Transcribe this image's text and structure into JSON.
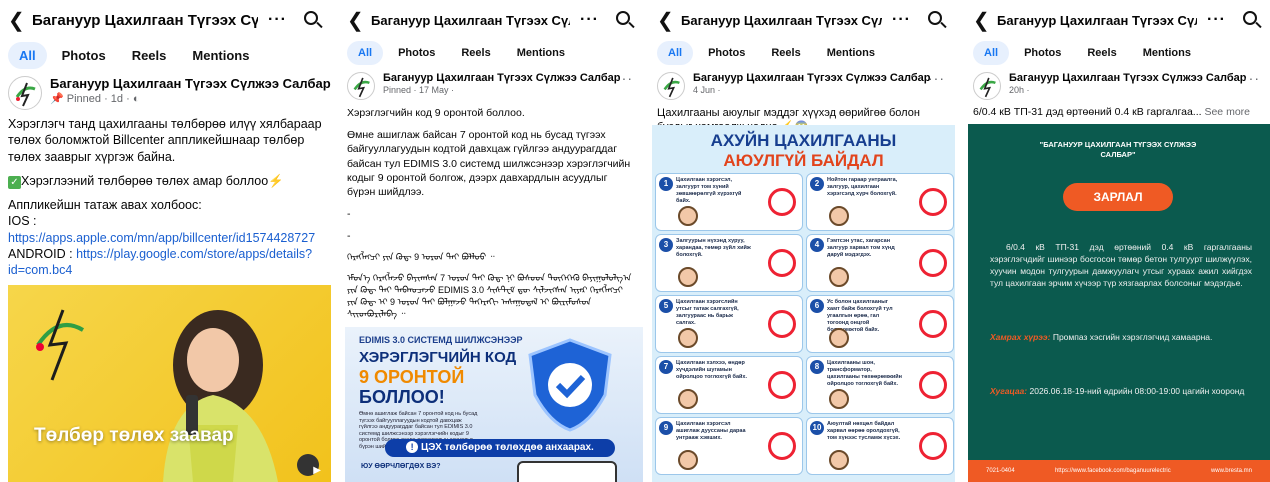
{
  "panel1": {
    "title": "Багануур Цахилгаан Түгээх Сүл...",
    "tabs": [
      "All",
      "Photos",
      "Reels",
      "Mentions"
    ],
    "page_name": "Багануур Цахилгаан Түгээх Сүлжээ Салбар",
    "meta": "Pinned · 1d ·",
    "text1": "Хэрэглэгч танд цахилгааны төлбөрөө илүү хялбараар төлөх боломжтой Billcenter аппликейшнаар төлбөр төлөх зааврыг хүргэж байна.",
    "text2": "Хэрэглээний төлбөрөө төлөх амар боллоо",
    "text3": "Аппликейшн татаж авах холбоос:",
    "ios_label": "IOS :",
    "ios_link": "https://apps.apple.com/mn/app/billcenter/id1574428727",
    "android_label": "ANDROID :",
    "android_link": "https://play.google.com/store/apps/details?id=com.bc4",
    "image_caption": "Төлбөр төлөх заавар"
  },
  "panel2": {
    "title": "Багануур Цахилгаан Түгээх Сүл...",
    "tabs": [
      "All",
      "Photos",
      "Reels",
      "Mentions"
    ],
    "page_name": "Багануур Цахилгаан Түгээх Сүлжээ Салбар",
    "meta": "Pinned · 17 May ·",
    "text1": "Хэрэглэгчийн код 9 оронтой боллоо.",
    "text2": "Өмне ашиглаж байсан 7 оронтой код нь бусад түгээх байгууллагуудын кодтой давхцаж гүйлгээ андуурагддаг байсан тул EDIMIS 3.0 системд шилжсэнээр хэрэглэгчийн кодыг 9 оронтой болгож, дээрх давхардлын асуудлыг бүрэн шийдлээ.",
    "dash1": "-",
    "dash2": "-",
    "mongol1": "ᠬᠡᠷᠡᠭᠯᠡᠭᠴᠢ ᠶᠢᠨ ᠺᠣᠳ᠋ 9 ᠣᠷᠣᠨ ᠲᠠᠢ ᠪᠣᠯᠯᠣᠣ ᠃",
    "mongol2": "ᠡᠮᠦᠨ᠎ᠡ ᠬᠡᠷᠡᠭᠯᠡᠵᠦ ᠪᠠᠶᠢᠭᠰᠠᠨ 7 ᠣᠷᠣᠨ ᠲᠠᠢ ᠺᠣᠳ᠋ ᠨᠢ ᠪᠤᠰᠤᠳ ᠲᠦᠭᠡᠭᠡᠬᠦ ᠪᠠᠶᠢᠭᠤᠯᠤᠯᠭ᠎ᠠ ᠶᠢᠨ ᠺᠣᠳ᠋ ᠲᠠᠢ ᠳᠠᠪᠬᠤᠴᠠᠵᠤ EDIMIS 3.0 ᠰᠢᠰᠲ᠋ᠧᠮ ᠳᠦ ᠰᠢᠯᠵᠢᠭᠰᠡᠨ ᠢᠶᠡᠷ ᠬᠡᠷᠡᠭᠯᠡᠭᠴᠢ ᠶᠢᠨ ᠺᠣᠳ᠋ ᠢ 9 ᠣᠷᠣᠨ ᠲᠠᠢ ᠪᠣᠯᠭᠠᠵᠤ ᠳᠡᠭᠡᠷᠡᠬᠢ ᠠᠰᠠᠭᠤᠳᠠᠯ ᠢ ᠪᠦᠷᠢᠮᠦᠰᠦᠨ ᠰᠢᠢᠳᠪᠦᠷᠢᠯᠡᠪᠡ ᠃",
    "img_system": "EDIMIS 3.0 СИСТЕМД ШИЛЖСЭНЭЭР",
    "img_headline1": "ХЭРЭГЛЭГЧИЙН КОД",
    "img_headline2": "9 ОРОНТОЙ",
    "img_headline3": "БОЛЛОО!",
    "img_small": "Өмнө ашиглаж байсан 7 оронтой код нь бусад түгээх байгууллагуудын кодтой давхцаж гүйлгээ андуурагддаг байсан тул EDIMIS 3.0 системд шилжсэнээр хэрэглэгчийн кодыг 9 оронтой болгож дээрх давхардлын асуудлыг бүрэн шийдлээ.",
    "img_banner": "ЦЭХ төлбөрөө төлөхдөө анхаарах.",
    "img_bottom": "ЮУ ӨӨРЧЛӨГДӨХ ВЭ?"
  },
  "panel3": {
    "title": "Багануур Цахилгаан Түгээх Сүл...",
    "tabs": [
      "All",
      "Photos",
      "Reels",
      "Mentions"
    ],
    "page_name": "Багануур Цахилгаан Түгээх Сүлжээ Салбар",
    "meta": "4 Jun ·",
    "text1": "Цахилгааны аюулыг мэддэг хүүхэд өөрийгөө болон бусдыг хамгаалж чадна",
    "poster_title1": "АХУЙН ЦАХИЛГААНЫ",
    "poster_title2": "АЮУЛГҮЙ БАЙДАЛ",
    "tips": [
      {
        "n": "1",
        "t": "Цахилгаан хэрэгсэл, залгуурт том хүний зөвшөөрөлгүй хүрэхгүй байх."
      },
      {
        "n": "2",
        "t": "Нойтон гараар унтраалга, залгуур, цахилгаан хэрэгсэлд хүрч болохгүй."
      },
      {
        "n": "3",
        "t": "Залгуурын нүхэнд хуруу, харандаа, төмөр зүйл хийж болохгүй."
      },
      {
        "n": "4",
        "t": "Гэмтсэн утас, хагарсан залгуур харвал том хүнд даруй мэдэгдэх."
      },
      {
        "n": "5",
        "t": "Цахилгаан хэрэгслийн утсыг татаж салгахгүй, залгуураас нь барьж салгах."
      },
      {
        "n": "6",
        "t": "Ус болон цахилгааныг хамт байж болохгүй тул угаалгын өрөө, гал тогоонд онцгой болгоомжтой байх."
      },
      {
        "n": "7",
        "t": "Цахилгаан хэлхээ, өндөр хүчдэлийн шугамын ойролцоо тоглохгүй байх."
      },
      {
        "n": "8",
        "t": "Цахилгааны шон, трансформатор, цахилгааны төхөөрөмжийн ойролцоо тоглохгүй байх."
      },
      {
        "n": "9",
        "t": "Цахилгаан хэрэгсэл ашиглаж дууссаны дараа унтрааж хэвших."
      },
      {
        "n": "10",
        "t": "Аюултай нөхцөл байдал харвал өөрөө оролдохгүй, том хүнээс тусламж хүсэх."
      }
    ]
  },
  "panel4": {
    "title": "Багануур Цахилгаан Түгээх Сүл...",
    "tabs": [
      "All",
      "Photos",
      "Reels",
      "Mentions"
    ],
    "page_name": "Багануур Цахилгаан Түгээх Сүлжээ Салбар",
    "meta": "20h ·",
    "text1": "6/0.4 кВ ТП-31 дэд өртөөний 0.4 кВ гаргалгаа...",
    "see_more": "See more",
    "org": "\"БАГАНУУР ЦАХИЛГААН ТҮГЭЭХ СҮЛЖЭЭ САЛБАР\"",
    "button": "ЗАРЛАЛ",
    "notice": "6/0.4 кВ ТП-31 дэд өртөөний 0.4 кВ гаргалгааны хэрэглэгчдийг шинээр босгосон төмөр бетон тулгуурт шилжүүлэх, хуучин модон тулгуурын дамжуулагч утсыг хураах ажил хийгдэх тул цахилгаан эрчим хүчээр түр хязгаарлах болсоныг мэдэгдье.",
    "area_label": "Хамрах хүрээ:",
    "area_value": "Промпаз хэсгийн хэрэглэгчид хамаарна.",
    "time_label": "Хугацаа:",
    "time_value": "2026.06.18-19-ний өдрийн 08:00-19:00 цагийн хооронд",
    "footer_phone": "7021-0404",
    "footer_fb": "https://www.facebook.com/baganuurelectric",
    "footer_web": "www.bresta.mn"
  },
  "colors": {
    "fb_blue": "#1877f2",
    "link": "#1a5fd0",
    "teal": "#0b5a4e",
    "orange": "#ef5a24",
    "yellow": "#f3d23c"
  }
}
